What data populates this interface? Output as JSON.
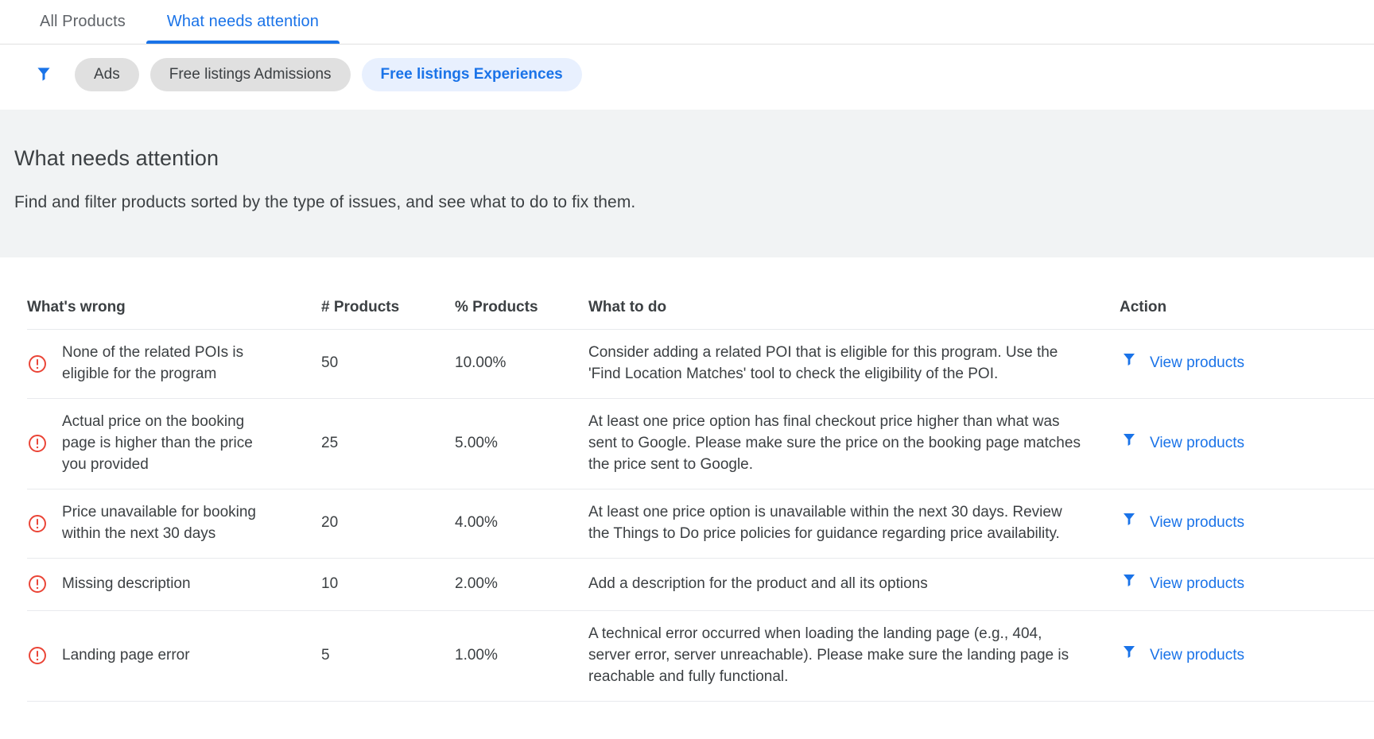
{
  "tabs": [
    {
      "label": "All Products",
      "active": false
    },
    {
      "label": "What needs attention",
      "active": true
    }
  ],
  "filters": {
    "icon": "filter-icon",
    "chips": [
      {
        "label": "Ads",
        "selected": false
      },
      {
        "label": "Free listings Admissions",
        "selected": false
      },
      {
        "label": "Free listings Experiences",
        "selected": true
      }
    ]
  },
  "banner": {
    "title": "What needs attention",
    "subtitle": "Find and filter products sorted by the type of issues, and see what to do to fix them."
  },
  "table": {
    "columns": [
      "What's wrong",
      "# Products",
      "% Products",
      "What to do",
      "Action"
    ],
    "action_label": "View products",
    "rows": [
      {
        "status_icon": "error-icon",
        "whats_wrong": "None of the related POIs is eligible for the program",
        "num_products": "50",
        "pct_products": "10.00%",
        "what_to_do": "Consider adding a related POI that is eligible for this program. Use the 'Find Location Matches' tool to check the eligibility of the POI.",
        "action": "View products"
      },
      {
        "status_icon": "error-icon",
        "whats_wrong": "Actual price on the booking page is higher than the price you provided",
        "num_products": "25",
        "pct_products": "5.00%",
        "what_to_do": "At least one price option has final checkout price higher than what was sent to Google. Please make sure the price on the booking page matches the price sent to Google.",
        "action": "View products"
      },
      {
        "status_icon": "error-icon",
        "whats_wrong": "Price unavailable for booking within the next 30 days",
        "num_products": "20",
        "pct_products": "4.00%",
        "what_to_do": "At least one price option is unavailable within the next 30 days. Review the Things to Do price policies for guidance regarding price availability.",
        "action": "View products"
      },
      {
        "status_icon": "error-icon",
        "whats_wrong": "Missing description",
        "num_products": "10",
        "pct_products": "2.00%",
        "what_to_do": "Add a description for the product and all its options",
        "action": "View products"
      },
      {
        "status_icon": "error-icon",
        "whats_wrong": "Landing page error",
        "num_products": "5",
        "pct_products": "1.00%",
        "what_to_do": "A technical error occurred when loading the landing page (e.g., 404, server error, server unreachable). Please make sure the landing page is reachable and fully functional.",
        "action": "View products"
      }
    ]
  },
  "colors": {
    "accent_blue": "#1a73e8",
    "chip_bg": "#e0e0e0",
    "chip_selected_bg": "#e8f0fe",
    "banner_bg": "#f1f3f4",
    "error_red": "#ea4335",
    "text_primary": "#3c4043",
    "text_secondary": "#5f6368",
    "divider": "#e8eaed"
  }
}
